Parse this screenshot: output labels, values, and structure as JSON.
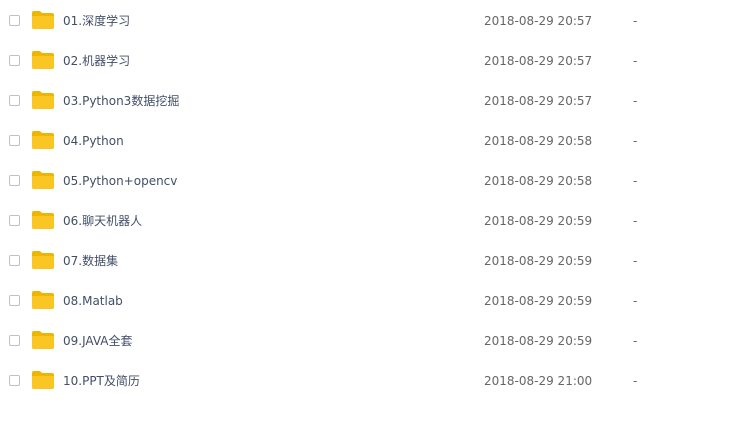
{
  "files": [
    {
      "name": "01.深度学习",
      "modified": "2018-08-29 20:57",
      "size": "-",
      "icon": "folder-icon"
    },
    {
      "name": "02.机器学习",
      "modified": "2018-08-29 20:57",
      "size": "-",
      "icon": "folder-icon"
    },
    {
      "name": "03.Python3数据挖掘",
      "modified": "2018-08-29 20:57",
      "size": "-",
      "icon": "folder-icon"
    },
    {
      "name": "04.Python",
      "modified": "2018-08-29 20:58",
      "size": "-",
      "icon": "folder-icon"
    },
    {
      "name": "05.Python+opencv",
      "modified": "2018-08-29 20:58",
      "size": "-",
      "icon": "folder-icon"
    },
    {
      "name": "06.聊天机器人",
      "modified": "2018-08-29 20:59",
      "size": "-",
      "icon": "folder-icon"
    },
    {
      "name": "07.数据集",
      "modified": "2018-08-29 20:59",
      "size": "-",
      "icon": "folder-icon"
    },
    {
      "name": "08.Matlab",
      "modified": "2018-08-29 20:59",
      "size": "-",
      "icon": "folder-icon"
    },
    {
      "name": "09.JAVA全套",
      "modified": "2018-08-29 20:59",
      "size": "-",
      "icon": "folder-icon"
    },
    {
      "name": "10.PPT及简历",
      "modified": "2018-08-29 21:00",
      "size": "-",
      "icon": "folder-icon"
    }
  ],
  "colors": {
    "folder": "#f9c623",
    "folder_tab": "#f0b500",
    "text": "#424e67",
    "meta_text": "#666666",
    "checkbox_border": "#b9c2cc"
  }
}
